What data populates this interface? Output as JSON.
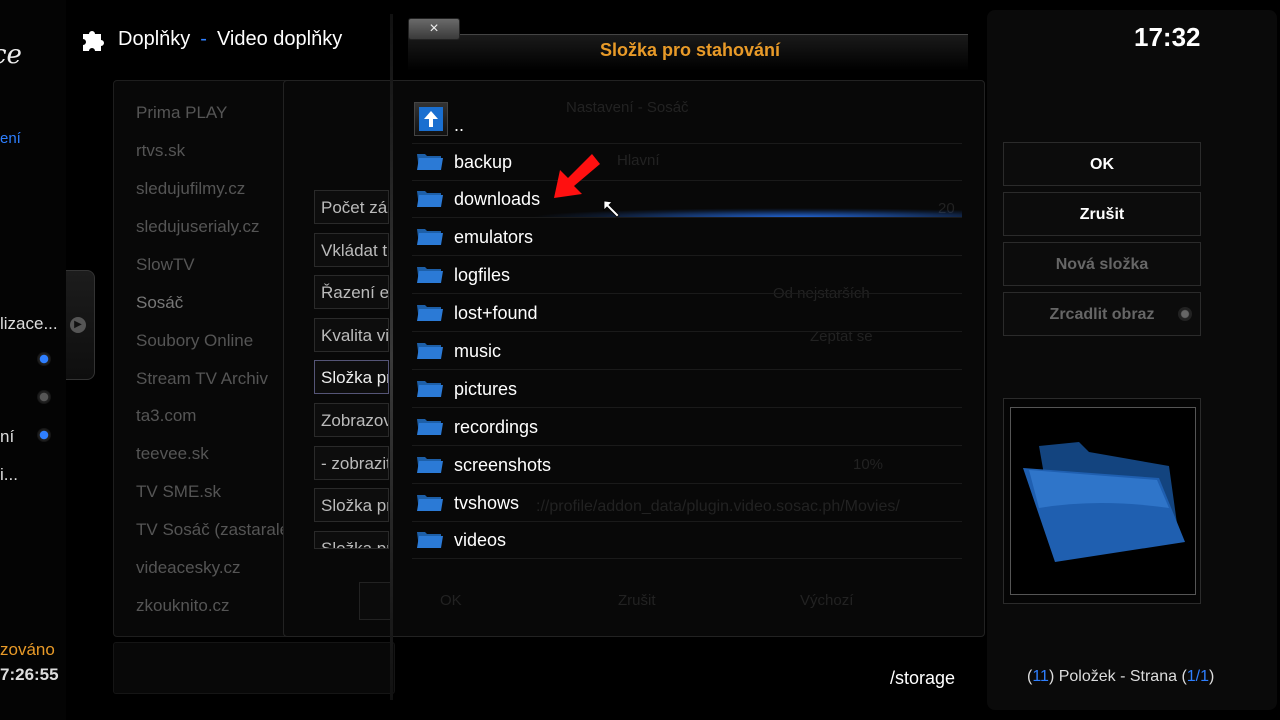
{
  "header": {
    "section": "Doplňky",
    "separator": "-",
    "subsection": "Video doplňky"
  },
  "left_sliver": {
    "logo_fragment": "ce",
    "blue_fragment": "ení",
    "item_1": "lizace...",
    "item_2": "ní",
    "item_3": "i...",
    "status_fragment": "zováno",
    "time_fragment": "7:26:55"
  },
  "addon_list": [
    "Prima PLAY",
    "rtvs.sk",
    "sledujufilmy.cz",
    "sledujuserialy.cz",
    "SlowTV",
    "Sosáč",
    "Soubory Online",
    "Stream TV Archiv",
    "ta3.com",
    "teevee.sk",
    "TV SME.sk",
    "TV Sosáč (zastaralé)",
    "videacesky.cz",
    "zkouknito.cz"
  ],
  "settings_rows": [
    "Počet záznamů",
    "Vkládat titulky",
    "Řazení epizod",
    "Kvalita videa",
    "Složka pro stahování",
    "Zobrazovat",
    "- zobrazit",
    "Složka pro filmy",
    "Složka pro seriály"
  ],
  "settings_ghost": {
    "title": "Nastavení - Sosáč",
    "tab": "Hlavní",
    "order_value": "Od nejstarších",
    "quality_value": "Zeptat se",
    "percent_value": "10%",
    "count_value": "20",
    "movies_path": "://profile/addon_data/plugin.video.sosac.ph/Movies/",
    "ok": "OK",
    "cancel": "Zrušit",
    "default": "Výchozí"
  },
  "dialog": {
    "close_label": "×",
    "title": "Složka pro stahování",
    "up_label": "..",
    "folders": [
      "backup",
      "downloads",
      "emulators",
      "logfiles",
      "lost+found",
      "music",
      "pictures",
      "recordings",
      "screenshots",
      "tvshows",
      "videos"
    ],
    "focused_folder": "downloads",
    "path": "/storage"
  },
  "right_panel": {
    "clock": "17:32",
    "ok_label": "OK",
    "cancel_label": "Zrušit",
    "new_folder_label": "Nová složka",
    "mirror_label": "Zrcadlit obraz",
    "status": {
      "open": "(",
      "count": "11",
      "middle": ") Položek - Strana (",
      "page": "1/1",
      "close": ")"
    }
  },
  "colors": {
    "accent_blue": "#2e7fff",
    "title_orange": "#e89a28",
    "background": "#000000"
  },
  "icons": [
    "puzzle-icon",
    "folder-icon",
    "folder-up-icon",
    "red-arrow-icon",
    "mouse-cursor-icon",
    "large-folder-icon"
  ]
}
